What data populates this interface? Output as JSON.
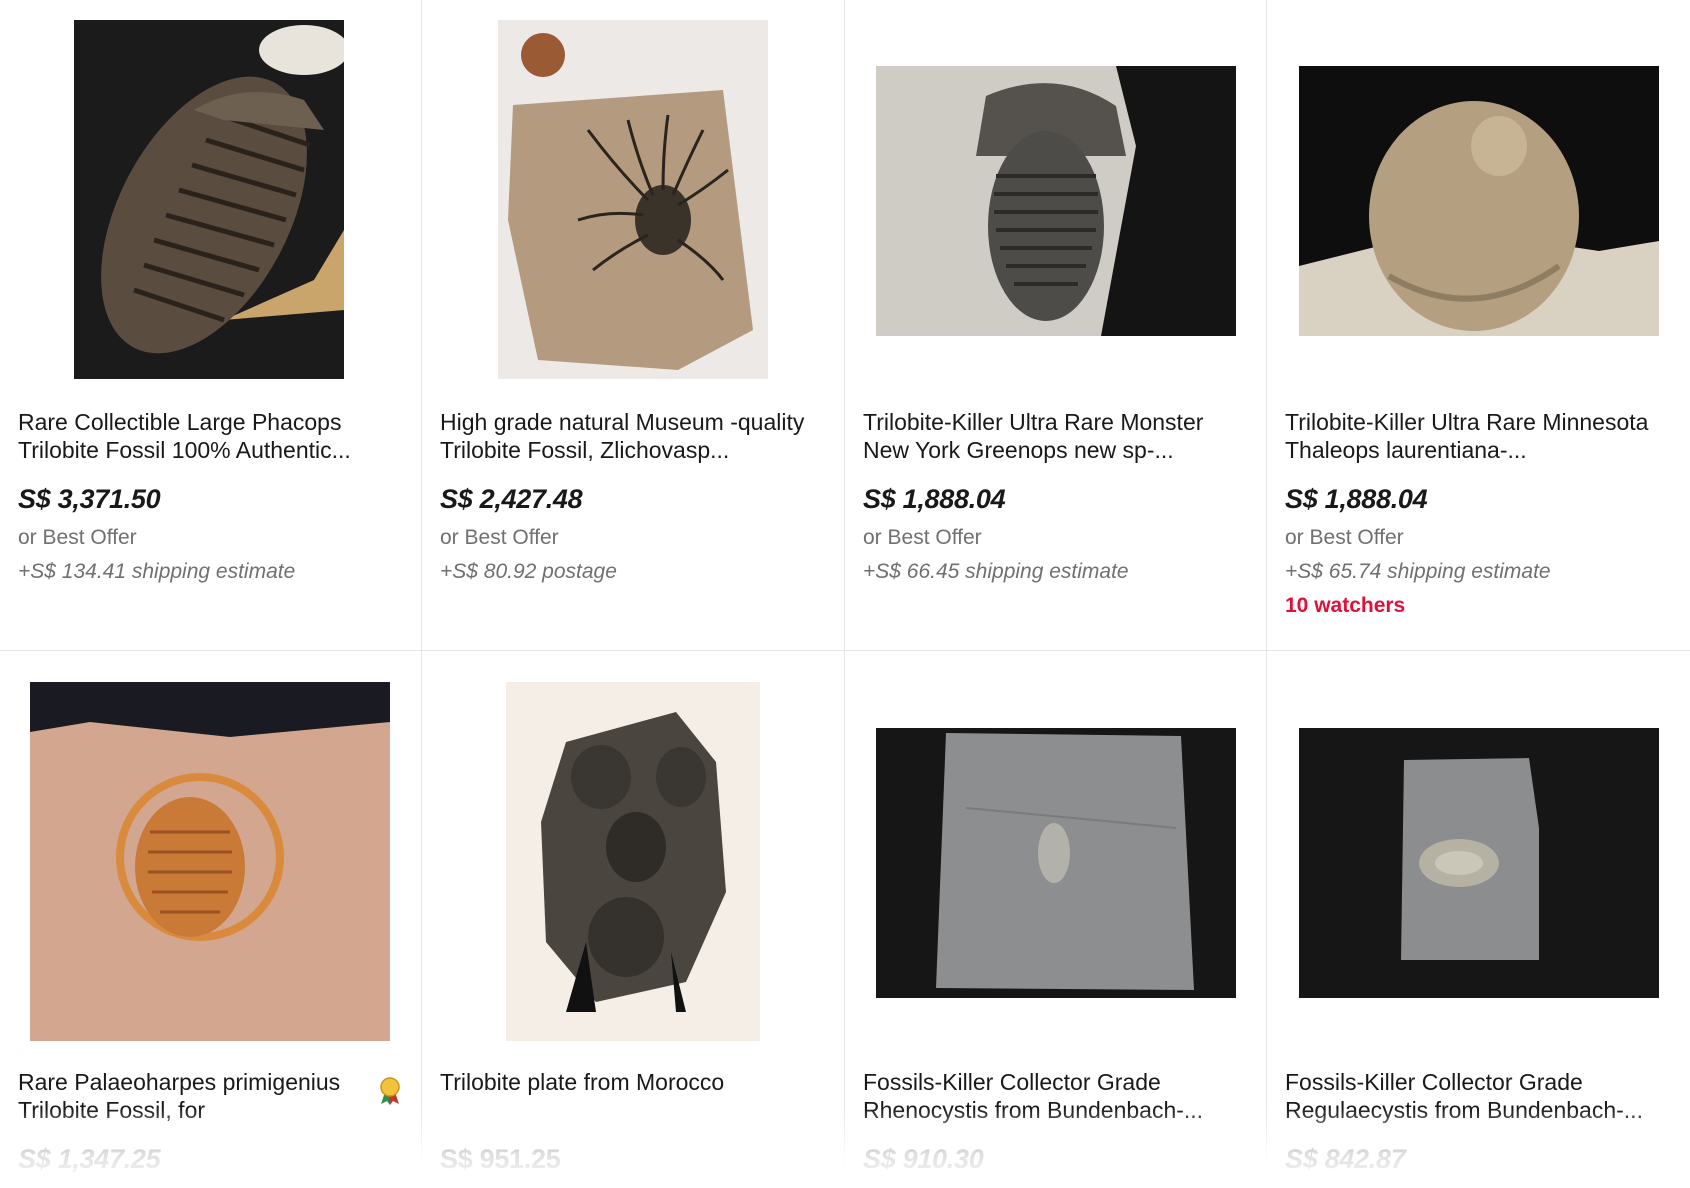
{
  "listings": [
    {
      "title": "Rare Collectible Large Phacops Trilobite Fossil 100% Authentic...",
      "price": "S$ 3,371.50",
      "offer": "or Best Offer",
      "shipping": "+S$ 134.41 shipping estimate",
      "image_icon": "trilobite-photo-icon"
    },
    {
      "title": " High grade natural Museum -quality Trilobite Fossil, Zlichovasp...",
      "price": "S$ 2,427.48",
      "offer": "or Best Offer",
      "shipping": "+S$ 80.92 postage",
      "image_icon": "spiny-trilobite-photo-icon"
    },
    {
      "title": "Trilobite-Killer Ultra Rare Monster New York Greenops new sp-...",
      "price": "S$ 1,888.04",
      "offer": "or Best Offer",
      "shipping": "+S$ 66.45 shipping estimate",
      "image_icon": "trilobite-photo-icon"
    },
    {
      "title": "Trilobite-Killer Ultra Rare Minnesota Thaleops laurentiana-...",
      "price": "S$ 1,888.04",
      "offer": "or Best Offer",
      "shipping": "+S$ 65.74 shipping estimate",
      "watchers": "10 watchers",
      "image_icon": "smooth-trilobite-photo-icon"
    },
    {
      "title": "Rare Palaeoharpes primigenius Trilobite Fossil, for",
      "price": "S$ 1,347.25",
      "badge_icon": "top-rated-seller-icon",
      "image_icon": "orange-trilobite-photo-icon"
    },
    {
      "title": "Trilobite plate from Morocco",
      "price": "S$ 951.25",
      "image_icon": "trilobite-plate-photo-icon"
    },
    {
      "title": "Fossils-Killer Collector Grade Rhenocystis from Bundenbach-...",
      "price": "S$ 910.30",
      "image_icon": "slate-fossil-photo-icon"
    },
    {
      "title": "Fossils-Killer Collector Grade Regulaecystis from Bundenbach-...",
      "price": "S$ 842.87",
      "image_icon": "slate-fossil-photo-icon"
    }
  ],
  "colors": {
    "watchers": "#e0103a",
    "secondary_text": "#707070",
    "divider": "#e5e5e5"
  }
}
